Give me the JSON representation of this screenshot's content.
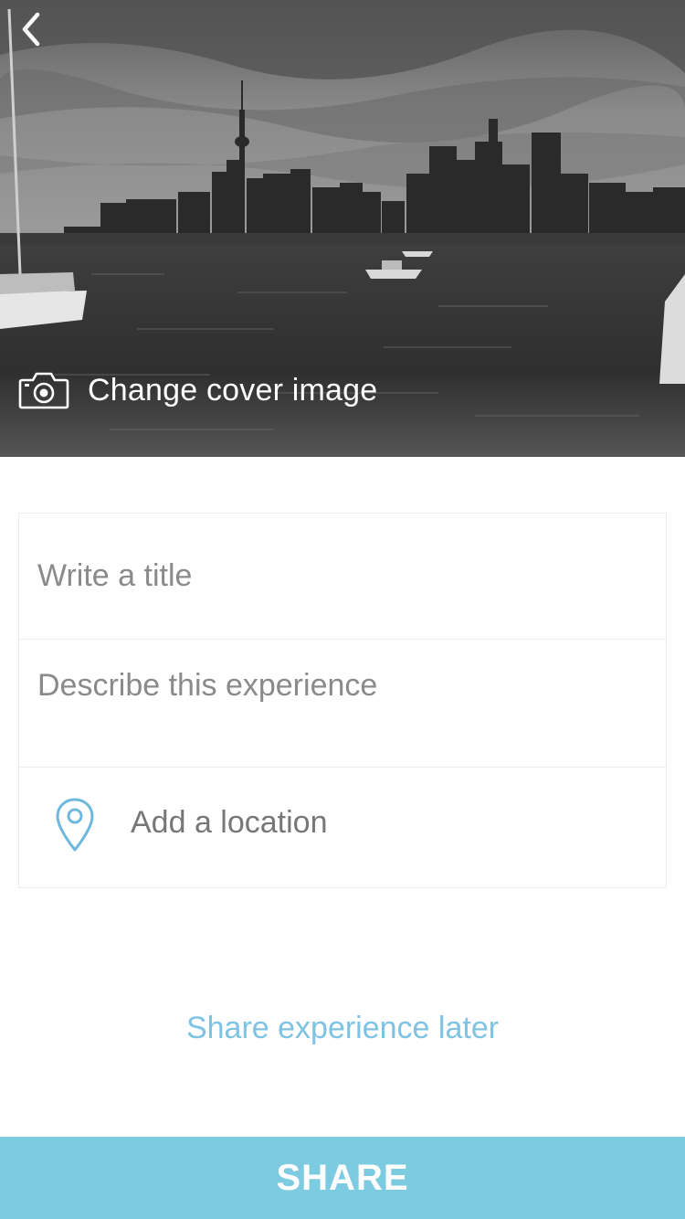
{
  "cover": {
    "change_cover_label": "Change cover image",
    "back_icon": "chevron-left-icon",
    "camera_icon": "camera-icon"
  },
  "form": {
    "title_placeholder": "Write a title",
    "description_placeholder": "Describe this experience",
    "location_label": "Add a location",
    "location_icon": "map-pin-icon"
  },
  "actions": {
    "share_later_label": "Share experience later",
    "share_button_label": "SHARE"
  },
  "colors": {
    "accent": "#7ccbe1",
    "link": "#7ec3e3",
    "pin": "#6fb8dd"
  }
}
